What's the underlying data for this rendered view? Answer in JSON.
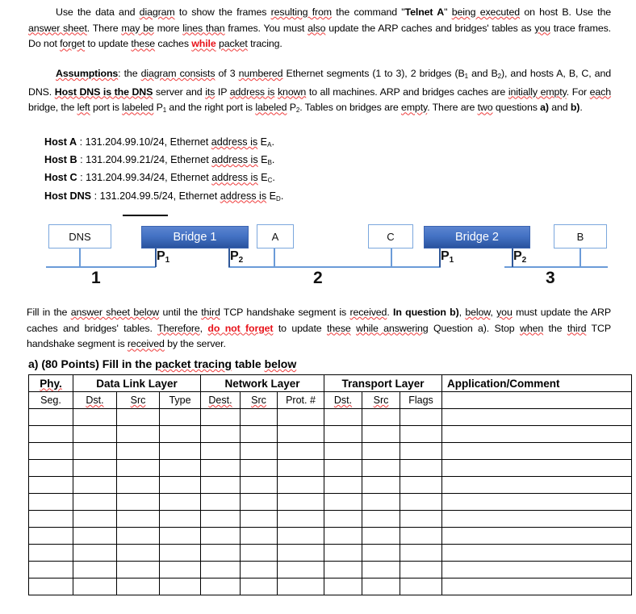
{
  "intro": {
    "line1_a": "Use the data and ",
    "line1_diagram": "diagram",
    "line1_b": " to show the frames ",
    "line1_resulting": "resulting from",
    "line1_c": " the command \"",
    "line1_cmd": "Telnet A",
    "line1_d": "\" ",
    "line1_being": "being executed",
    "line1_e": " on host B. Use the ",
    "line1_answersheet": "answer sheet",
    "line1_f": ". There ",
    "line1_maybe": "may be",
    "line1_g": " more ",
    "line1_linesthan": "lines than",
    "line1_h": " frames. You must ",
    "line1_also": "also",
    "line1_i": " update the ARP caches and bridges' tables as ",
    "line1_you": "you",
    "line1_j": " trace frames. Do not ",
    "line1_forget": "forget",
    "line1_k": " to update ",
    "line1_these": "these",
    "line1_l": " caches ",
    "line1_while": "while",
    "line1_m": " ",
    "line1_packet": "packet",
    "line1_n": " tracing."
  },
  "assumptions": {
    "label": "Assumptions",
    "a": ": the ",
    "diagram_consists": "diagram consists",
    "b": " of 3 ",
    "numbered": "numbered",
    "c": " Ethernet segments (1 to 3), 2 bridges (B",
    "sub1": "1",
    "d": " and B",
    "sub2": "2",
    "e": "), and hosts A, B, C, and DNS. ",
    "hostdns_bold": "Host DNS is the DNS",
    "f": " server and ",
    "its": "its",
    "g": " IP ",
    "address_is": "address is",
    "h": " ",
    "known": "known",
    "i": " to all machines. ARP and bridges caches are ",
    "initially_empty": "initially empty",
    "j": ". For ",
    "each": "each",
    "k": " bridge, the ",
    "left": "left",
    "l": " port is ",
    "labeled1": "labeled",
    "m": " P",
    "subp1": "1",
    "n": " and the right port is ",
    "labeled2": "labeled",
    "o": " P",
    "subp2": "2",
    "p": ". Tables on bridges are ",
    "empty": "empty",
    "q": ". There are ",
    "two": "two",
    "r": " questions ",
    "a_bold": "a)",
    "s": " and ",
    "b_bold": "b)",
    "t": "."
  },
  "hosts": [
    {
      "name": "Host A",
      "detail": " : 131.204.99.10/24, Ethernet ",
      "addr_sq": "address is",
      "eth": " E",
      "ethsub": "A",
      "end": "."
    },
    {
      "name": "Host B",
      "detail": " : 131.204.99.21/24, Ethernet ",
      "addr_sq": "address is",
      "eth": " E",
      "ethsub": "B",
      "end": "."
    },
    {
      "name": "Host C",
      "detail": " : 131.204.99.34/24, Ethernet ",
      "addr_sq": "address is",
      "eth": " E",
      "ethsub": "C",
      "end": "."
    },
    {
      "name": "Host DNS",
      "detail": " : 131.204.99.5/24, Ethernet ",
      "addr_sq": "address is",
      "eth": " E",
      "ethsub": "D",
      "end": "."
    }
  ],
  "diagram": {
    "nodes": [
      {
        "id": "dns",
        "label": "DNS"
      },
      {
        "id": "a",
        "label": "A"
      },
      {
        "id": "c",
        "label": "C"
      },
      {
        "id": "b",
        "label": "B"
      }
    ],
    "bridges": [
      {
        "id": "bridge1",
        "label": "Bridge 1",
        "port_left": "P",
        "port_left_sub": "1",
        "port_right": "P",
        "port_right_sub": "2"
      },
      {
        "id": "bridge2",
        "label": "Bridge 2",
        "port_left": "P",
        "port_left_sub": "1",
        "port_right": "P",
        "port_right_sub": "2"
      }
    ],
    "segments": [
      {
        "id": "seg1",
        "label": "1"
      },
      {
        "id": "seg2",
        "label": "2"
      },
      {
        "id": "seg3",
        "label": "3"
      }
    ],
    "colors": {
      "bridge_fill": "#4472C4",
      "node_border": "#7ba7dd",
      "bus_line": "#6b9bd8"
    }
  },
  "instructions": {
    "a": "Fill in the ",
    "answersheet": "answer sheet below",
    "b": " until the ",
    "third1": "third",
    "c": " TCP handshake segment is ",
    "received1": "received",
    "d": ". ",
    "inquestionb": "In question b)",
    "e": ", ",
    "below": "below",
    "f": ", ",
    "you": "you",
    "g": " must update the ARP caches and bridges' tables. ",
    "therefore": "Therefore",
    "h": ", ",
    "donotforget": "do not forget",
    "i": " to update ",
    "these": "these",
    "j": " ",
    "whileanswering": "while answering",
    "k": " Question a). Stop ",
    "when": "when",
    "l": " the ",
    "third2": "third",
    "m": " TCP handshake segment is ",
    "received2": "received",
    "n": " by the server."
  },
  "question_a": {
    "letter": "a)",
    "points": " (80 Points)",
    "rest_a": " Fill in the ",
    "packet": "packet tracing",
    "rest_b": " table ",
    "below": "below"
  },
  "table": {
    "group_headers": [
      {
        "label": "Phy.",
        "sq": true
      },
      {
        "label": "Data Link Layer",
        "sq": false
      },
      {
        "label": "Network Layer",
        "sq": false
      },
      {
        "label": "Transport Layer",
        "sq": false
      },
      {
        "label": "Application/Comment",
        "sq": false
      }
    ],
    "sub_headers": [
      {
        "label": "Seg.",
        "sq": false
      },
      {
        "label": "Dst.",
        "sq": true
      },
      {
        "label": "Src",
        "sq": true
      },
      {
        "label": "Type",
        "sq": false
      },
      {
        "label": "Dest.",
        "sq": true
      },
      {
        "label": "Src",
        "sq": true
      },
      {
        "label": "Prot. #",
        "sq": false
      },
      {
        "label": "Dst.",
        "sq": true
      },
      {
        "label": "Src",
        "sq": true
      },
      {
        "label": "Flags",
        "sq": false
      },
      {
        "label": "",
        "sq": false
      }
    ],
    "empty_row_count": 11
  }
}
